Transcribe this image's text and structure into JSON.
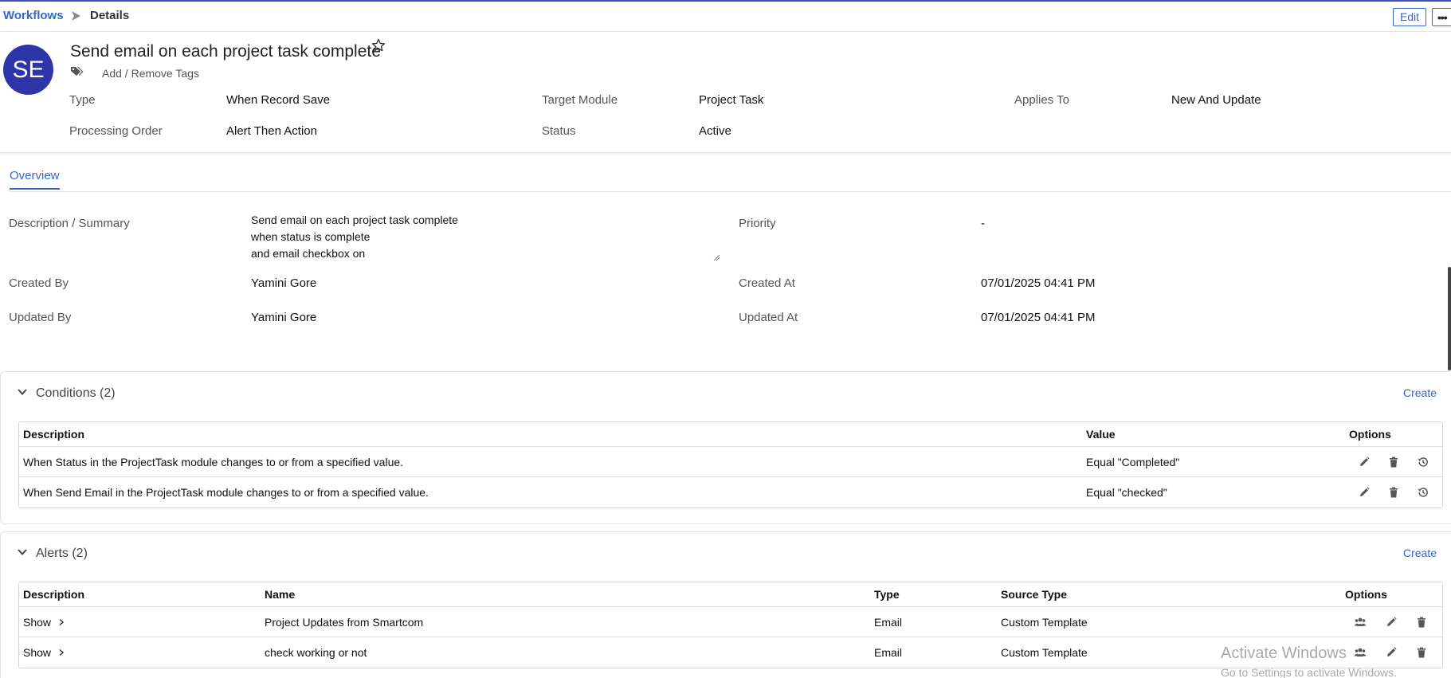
{
  "breadcrumb": {
    "root": "Workflows",
    "current": "Details"
  },
  "actions": {
    "edit_label": "Edit",
    "more_label": "•••"
  },
  "record": {
    "avatar_initials": "SE",
    "title": "Send email on each project task complete",
    "tags_label": "Add / Remove Tags"
  },
  "meta": {
    "type_label": "Type",
    "type_value": "When Record Save",
    "target_label": "Target Module",
    "target_value": "Project Task",
    "applies_label": "Applies To",
    "applies_value": "New And Update",
    "order_label": "Processing Order",
    "order_value": "Alert Then Action",
    "status_label": "Status",
    "status_value": "Active"
  },
  "tabs": [
    {
      "label": "Overview"
    }
  ],
  "overview": {
    "desc_label": "Description / Summary",
    "desc_lines": [
      "Send email on each project task complete",
      "when status is complete",
      "and email checkbox on"
    ],
    "priority_label": "Priority",
    "priority_value": "-",
    "created_by_label": "Created By",
    "created_by_value": "Yamini Gore",
    "created_at_label": "Created At",
    "created_at_value": "07/01/2025 04:41 PM",
    "updated_by_label": "Updated By",
    "updated_by_value": "Yamini Gore",
    "updated_at_label": "Updated At",
    "updated_at_value": "07/01/2025 04:41 PM"
  },
  "conditions": {
    "heading": "Conditions (2)",
    "create_label": "Create",
    "columns": [
      "Description",
      "Value",
      "Options"
    ],
    "rows": [
      {
        "description": "When Status in the ProjectTask module changes to or from a specified value.",
        "value": "Equal \"Completed\""
      },
      {
        "description": "When Send Email in the ProjectTask module changes to or from a specified value.",
        "value": "Equal \"checked\""
      }
    ]
  },
  "alerts": {
    "heading": "Alerts (2)",
    "create_label": "Create",
    "columns": [
      "Description",
      "Name",
      "Type",
      "Source Type",
      "Options"
    ],
    "rows": [
      {
        "description": "Show",
        "name": "Project Updates from Smartcom",
        "type": "Email",
        "source_type": "Custom Template"
      },
      {
        "description": "Show",
        "name": "check working or not",
        "type": "Email",
        "source_type": "Custom Template"
      }
    ]
  },
  "watermark": {
    "line1": "Activate Windows",
    "line2": "Go to Settings to activate Windows."
  },
  "colors": {
    "accent": "#3568c8",
    "avatar_bg": "#2e35a8",
    "top_rule": "#3b4fc0"
  },
  "icons": [
    "chevron-right-icon",
    "star-icon",
    "tags-icon",
    "chevron-down-icon",
    "pencil-icon",
    "trash-icon",
    "history-icon",
    "users-icon"
  ]
}
